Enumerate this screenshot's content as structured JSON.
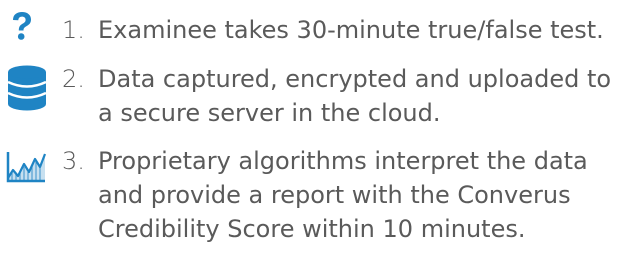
{
  "colors": {
    "text": "#5a5a5a",
    "accent": "#1f84c4"
  },
  "steps": [
    {
      "icon": "question-mark-icon",
      "number": "1.",
      "lines": [
        "Examinee takes 30-minute true/false test."
      ]
    },
    {
      "icon": "database-icon",
      "number": "2.",
      "lines": [
        "Data captured, encrypted and uploaded to",
        "a secure server in the cloud."
      ]
    },
    {
      "icon": "line-chart-icon",
      "number": "3.",
      "lines": [
        "Proprietary algorithms interpret the data",
        "and provide a report with the Converus",
        "Credibility Score within 10 minutes."
      ]
    }
  ]
}
